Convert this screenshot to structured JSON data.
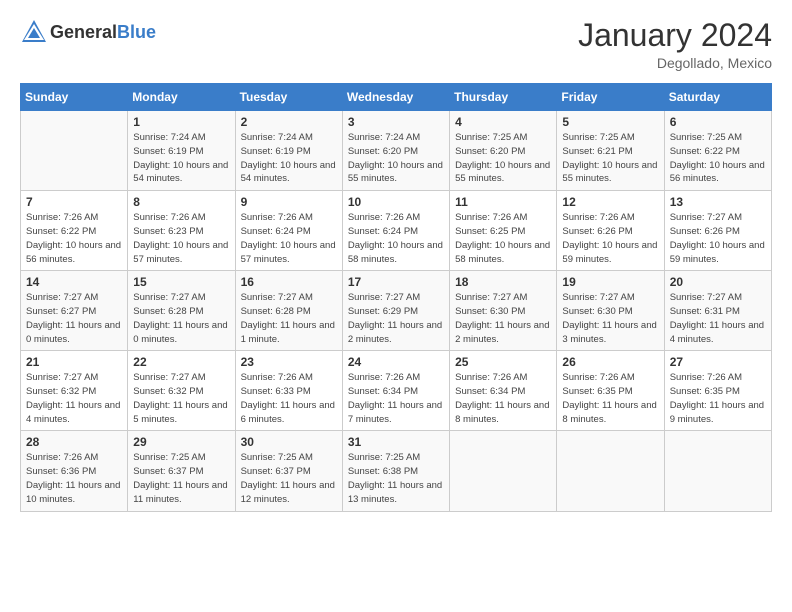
{
  "header": {
    "logo_general": "General",
    "logo_blue": "Blue",
    "month_year": "January 2024",
    "location": "Degollado, Mexico"
  },
  "weekdays": [
    "Sunday",
    "Monday",
    "Tuesday",
    "Wednesday",
    "Thursday",
    "Friday",
    "Saturday"
  ],
  "weeks": [
    [
      {
        "day": "",
        "sunrise": "",
        "sunset": "",
        "daylight": ""
      },
      {
        "day": "1",
        "sunrise": "Sunrise: 7:24 AM",
        "sunset": "Sunset: 6:19 PM",
        "daylight": "Daylight: 10 hours and 54 minutes."
      },
      {
        "day": "2",
        "sunrise": "Sunrise: 7:24 AM",
        "sunset": "Sunset: 6:19 PM",
        "daylight": "Daylight: 10 hours and 54 minutes."
      },
      {
        "day": "3",
        "sunrise": "Sunrise: 7:24 AM",
        "sunset": "Sunset: 6:20 PM",
        "daylight": "Daylight: 10 hours and 55 minutes."
      },
      {
        "day": "4",
        "sunrise": "Sunrise: 7:25 AM",
        "sunset": "Sunset: 6:20 PM",
        "daylight": "Daylight: 10 hours and 55 minutes."
      },
      {
        "day": "5",
        "sunrise": "Sunrise: 7:25 AM",
        "sunset": "Sunset: 6:21 PM",
        "daylight": "Daylight: 10 hours and 55 minutes."
      },
      {
        "day": "6",
        "sunrise": "Sunrise: 7:25 AM",
        "sunset": "Sunset: 6:22 PM",
        "daylight": "Daylight: 10 hours and 56 minutes."
      }
    ],
    [
      {
        "day": "7",
        "sunrise": "Sunrise: 7:26 AM",
        "sunset": "Sunset: 6:22 PM",
        "daylight": "Daylight: 10 hours and 56 minutes."
      },
      {
        "day": "8",
        "sunrise": "Sunrise: 7:26 AM",
        "sunset": "Sunset: 6:23 PM",
        "daylight": "Daylight: 10 hours and 57 minutes."
      },
      {
        "day": "9",
        "sunrise": "Sunrise: 7:26 AM",
        "sunset": "Sunset: 6:24 PM",
        "daylight": "Daylight: 10 hours and 57 minutes."
      },
      {
        "day": "10",
        "sunrise": "Sunrise: 7:26 AM",
        "sunset": "Sunset: 6:24 PM",
        "daylight": "Daylight: 10 hours and 58 minutes."
      },
      {
        "day": "11",
        "sunrise": "Sunrise: 7:26 AM",
        "sunset": "Sunset: 6:25 PM",
        "daylight": "Daylight: 10 hours and 58 minutes."
      },
      {
        "day": "12",
        "sunrise": "Sunrise: 7:26 AM",
        "sunset": "Sunset: 6:26 PM",
        "daylight": "Daylight: 10 hours and 59 minutes."
      },
      {
        "day": "13",
        "sunrise": "Sunrise: 7:27 AM",
        "sunset": "Sunset: 6:26 PM",
        "daylight": "Daylight: 10 hours and 59 minutes."
      }
    ],
    [
      {
        "day": "14",
        "sunrise": "Sunrise: 7:27 AM",
        "sunset": "Sunset: 6:27 PM",
        "daylight": "Daylight: 11 hours and 0 minutes."
      },
      {
        "day": "15",
        "sunrise": "Sunrise: 7:27 AM",
        "sunset": "Sunset: 6:28 PM",
        "daylight": "Daylight: 11 hours and 0 minutes."
      },
      {
        "day": "16",
        "sunrise": "Sunrise: 7:27 AM",
        "sunset": "Sunset: 6:28 PM",
        "daylight": "Daylight: 11 hours and 1 minute."
      },
      {
        "day": "17",
        "sunrise": "Sunrise: 7:27 AM",
        "sunset": "Sunset: 6:29 PM",
        "daylight": "Daylight: 11 hours and 2 minutes."
      },
      {
        "day": "18",
        "sunrise": "Sunrise: 7:27 AM",
        "sunset": "Sunset: 6:30 PM",
        "daylight": "Daylight: 11 hours and 2 minutes."
      },
      {
        "day": "19",
        "sunrise": "Sunrise: 7:27 AM",
        "sunset": "Sunset: 6:30 PM",
        "daylight": "Daylight: 11 hours and 3 minutes."
      },
      {
        "day": "20",
        "sunrise": "Sunrise: 7:27 AM",
        "sunset": "Sunset: 6:31 PM",
        "daylight": "Daylight: 11 hours and 4 minutes."
      }
    ],
    [
      {
        "day": "21",
        "sunrise": "Sunrise: 7:27 AM",
        "sunset": "Sunset: 6:32 PM",
        "daylight": "Daylight: 11 hours and 4 minutes."
      },
      {
        "day": "22",
        "sunrise": "Sunrise: 7:27 AM",
        "sunset": "Sunset: 6:32 PM",
        "daylight": "Daylight: 11 hours and 5 minutes."
      },
      {
        "day": "23",
        "sunrise": "Sunrise: 7:26 AM",
        "sunset": "Sunset: 6:33 PM",
        "daylight": "Daylight: 11 hours and 6 minutes."
      },
      {
        "day": "24",
        "sunrise": "Sunrise: 7:26 AM",
        "sunset": "Sunset: 6:34 PM",
        "daylight": "Daylight: 11 hours and 7 minutes."
      },
      {
        "day": "25",
        "sunrise": "Sunrise: 7:26 AM",
        "sunset": "Sunset: 6:34 PM",
        "daylight": "Daylight: 11 hours and 8 minutes."
      },
      {
        "day": "26",
        "sunrise": "Sunrise: 7:26 AM",
        "sunset": "Sunset: 6:35 PM",
        "daylight": "Daylight: 11 hours and 8 minutes."
      },
      {
        "day": "27",
        "sunrise": "Sunrise: 7:26 AM",
        "sunset": "Sunset: 6:35 PM",
        "daylight": "Daylight: 11 hours and 9 minutes."
      }
    ],
    [
      {
        "day": "28",
        "sunrise": "Sunrise: 7:26 AM",
        "sunset": "Sunset: 6:36 PM",
        "daylight": "Daylight: 11 hours and 10 minutes."
      },
      {
        "day": "29",
        "sunrise": "Sunrise: 7:25 AM",
        "sunset": "Sunset: 6:37 PM",
        "daylight": "Daylight: 11 hours and 11 minutes."
      },
      {
        "day": "30",
        "sunrise": "Sunrise: 7:25 AM",
        "sunset": "Sunset: 6:37 PM",
        "daylight": "Daylight: 11 hours and 12 minutes."
      },
      {
        "day": "31",
        "sunrise": "Sunrise: 7:25 AM",
        "sunset": "Sunset: 6:38 PM",
        "daylight": "Daylight: 11 hours and 13 minutes."
      },
      {
        "day": "",
        "sunrise": "",
        "sunset": "",
        "daylight": ""
      },
      {
        "day": "",
        "sunrise": "",
        "sunset": "",
        "daylight": ""
      },
      {
        "day": "",
        "sunrise": "",
        "sunset": "",
        "daylight": ""
      }
    ]
  ]
}
